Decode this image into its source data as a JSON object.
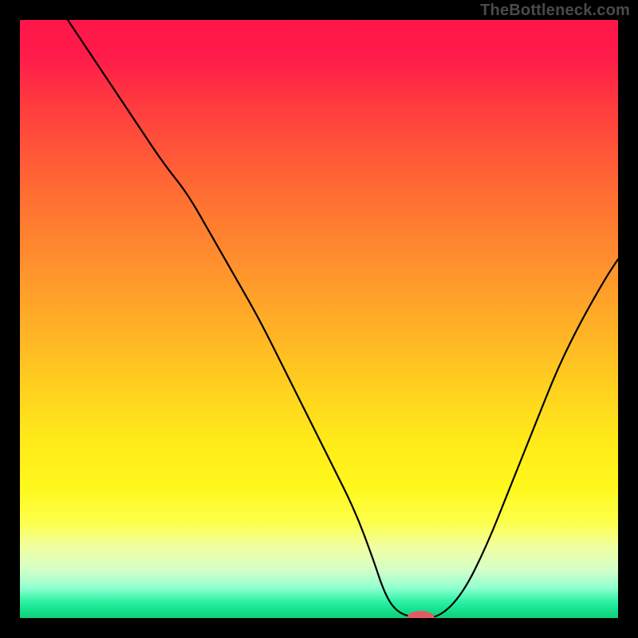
{
  "watermark": "TheBottleneck.com",
  "colors": {
    "background": "#000000",
    "gradient_top": "#ff1649",
    "gradient_mid": "#ffd21e",
    "gradient_bottom": "#0fcf76",
    "curve": "#000000",
    "marker": "#e45a64"
  },
  "chart_data": {
    "type": "line",
    "title": "",
    "xlabel": "",
    "ylabel": "",
    "xlim": [
      0,
      100
    ],
    "ylim": [
      0,
      100
    ],
    "grid": false,
    "legend": false,
    "series": [
      {
        "name": "bottleneck-curve",
        "x": [
          8,
          12,
          16,
          20,
          24,
          28,
          32,
          36,
          40,
          44,
          48,
          52,
          56,
          59,
          61,
          63,
          66,
          70,
          74,
          78,
          82,
          86,
          90,
          94,
          98,
          100
        ],
        "y": [
          100,
          94,
          88,
          82,
          76,
          71,
          64,
          57,
          50,
          42,
          34,
          26,
          18,
          10,
          4,
          1,
          0,
          0,
          4,
          12,
          22,
          32,
          42,
          50,
          57,
          60
        ]
      }
    ],
    "marker": {
      "x": 67,
      "y": 0,
      "rx": 2.3,
      "ry": 1.2
    },
    "notes": "Y axis is inverted visually: y=0 at bottom (green), y=100 at top (red). Values estimated from pixel positions; no axis ticks or labels visible."
  }
}
